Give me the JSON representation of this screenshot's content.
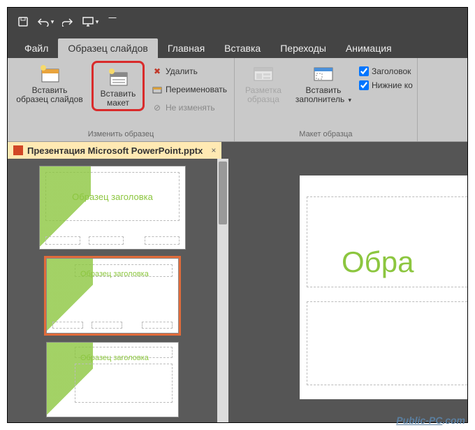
{
  "qat": {
    "save": "save-icon",
    "undo": "undo-icon",
    "redo": "redo-icon",
    "slideshow": "slideshow-icon"
  },
  "tabs": {
    "file": "Файл",
    "slidemaster": "Образец слайдов",
    "home": "Главная",
    "insert": "Вставка",
    "transitions": "Переходы",
    "animations": "Анимация"
  },
  "ribbon": {
    "group1": {
      "insert_master_l1": "Вставить",
      "insert_master_l2": "образец слайдов",
      "insert_layout_l1": "Вставить",
      "insert_layout_l2": "макет",
      "delete": "Удалить",
      "rename": "Переименовать",
      "preserve": "Не изменять",
      "label": "Изменить образец"
    },
    "group2": {
      "master_layout_l1": "Разметка",
      "master_layout_l2": "образца",
      "insert_ph_l1": "Вставить",
      "insert_ph_l2": "заполнитель",
      "title_cb": "Заголовок",
      "footers_cb": "Нижние ко",
      "label": "Макет образца"
    }
  },
  "doc": {
    "filename": "Презентация Microsoft PowerPoint.pptx",
    "close": "×"
  },
  "thumbs": {
    "master_title": "Образец заголовка",
    "layout_title": "Образец заголовка"
  },
  "slide": {
    "title_text": "Обра"
  },
  "watermark": {
    "p1": "Public-PC",
    "p2": ".com"
  }
}
